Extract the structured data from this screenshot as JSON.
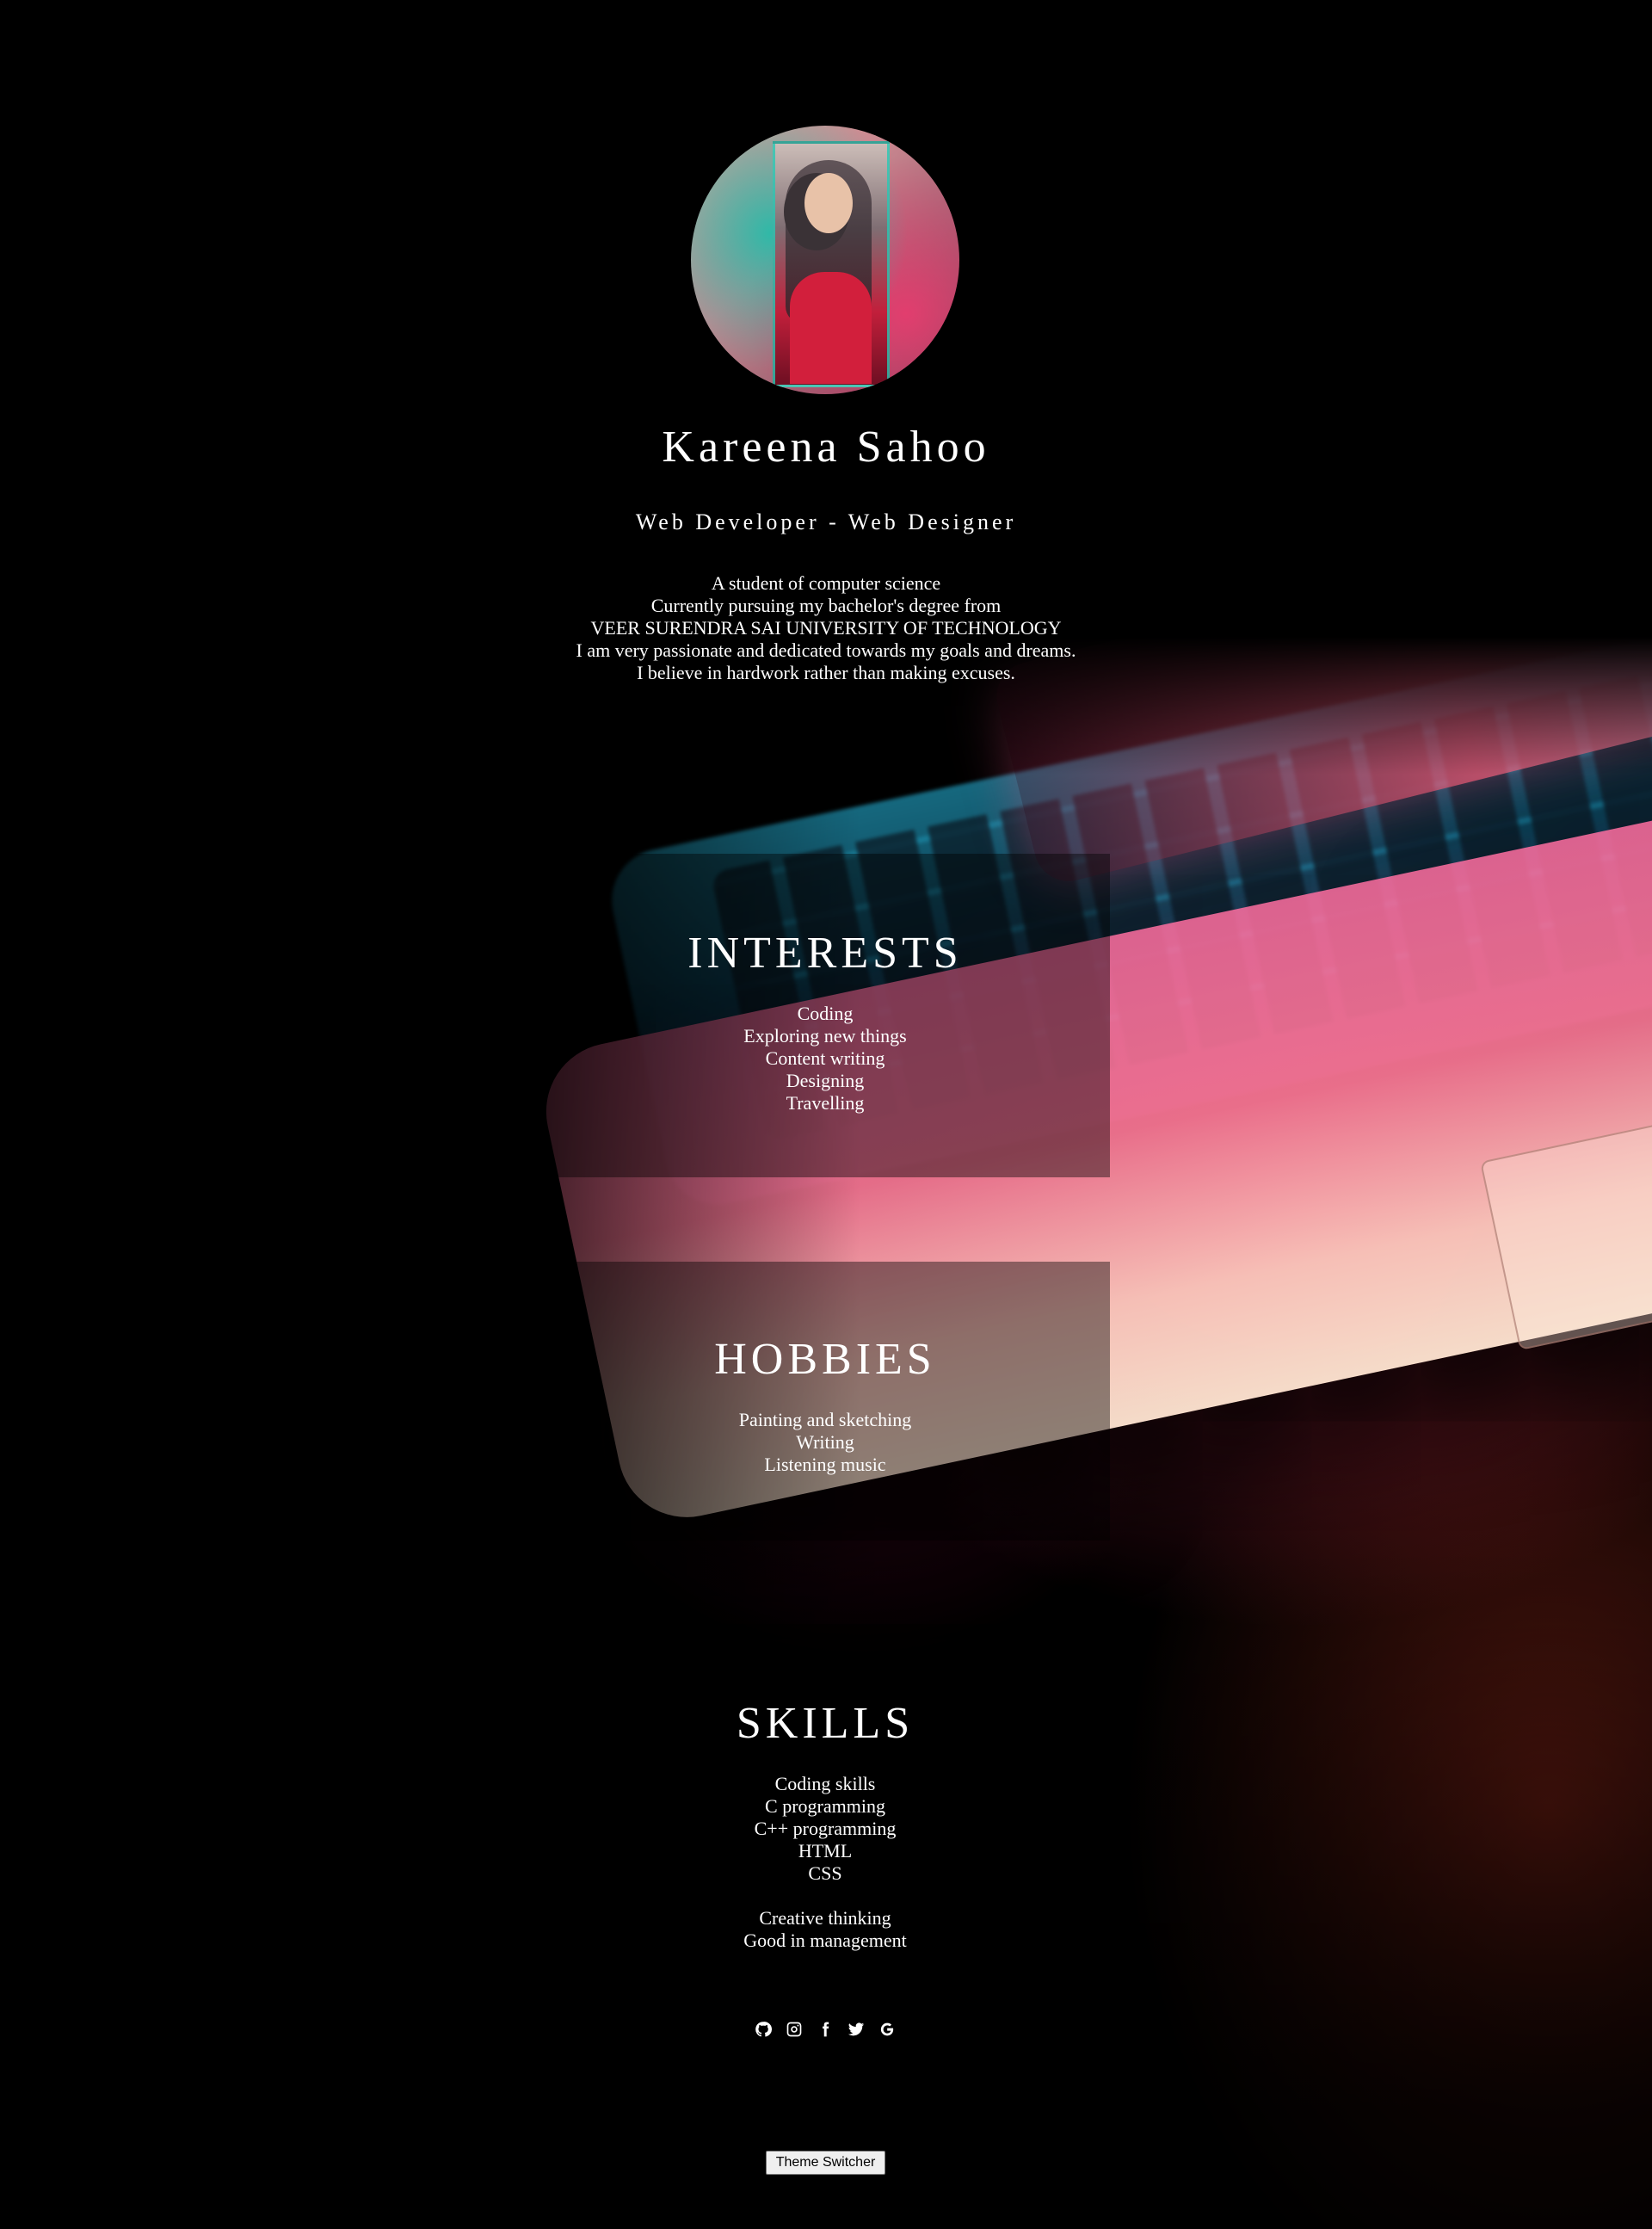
{
  "profile": {
    "name": "Kareena Sahoo",
    "role": "Web Developer - Web Designer",
    "about": [
      "A student of computer science",
      "Currently pursuing my bachelor's degree from",
      "VEER SURENDRA SAI UNIVERSITY OF TECHNOLOGY",
      "I am very passionate and dedicated towards my goals and dreams.",
      "I believe in hardwork rather than making excuses."
    ]
  },
  "interests": {
    "heading": "INTERESTS",
    "items": [
      "Coding",
      "Exploring new things",
      "Content writing",
      "Designing",
      "Travelling"
    ]
  },
  "hobbies": {
    "heading": "HOBBIES",
    "items": [
      "Painting and sketching",
      "Writing",
      "Listening music"
    ]
  },
  "skills": {
    "heading": "SKILLS",
    "technical": [
      "Coding skills",
      "C programming",
      "C++ programming",
      "HTML",
      "CSS"
    ],
    "soft": [
      "Creative thinking",
      "Good in management"
    ]
  },
  "social_icons": [
    "github-icon",
    "instagram-icon",
    "facebook-icon",
    "twitter-icon",
    "google-icon"
  ],
  "theme_button": {
    "label": "Theme Switcher"
  },
  "colors": {
    "background": "#000000",
    "text": "#ffffff",
    "panel": "rgba(0,0,0,0.42)",
    "laptop_pink": "#f0648c",
    "laptop_cyan": "#28bee6"
  }
}
